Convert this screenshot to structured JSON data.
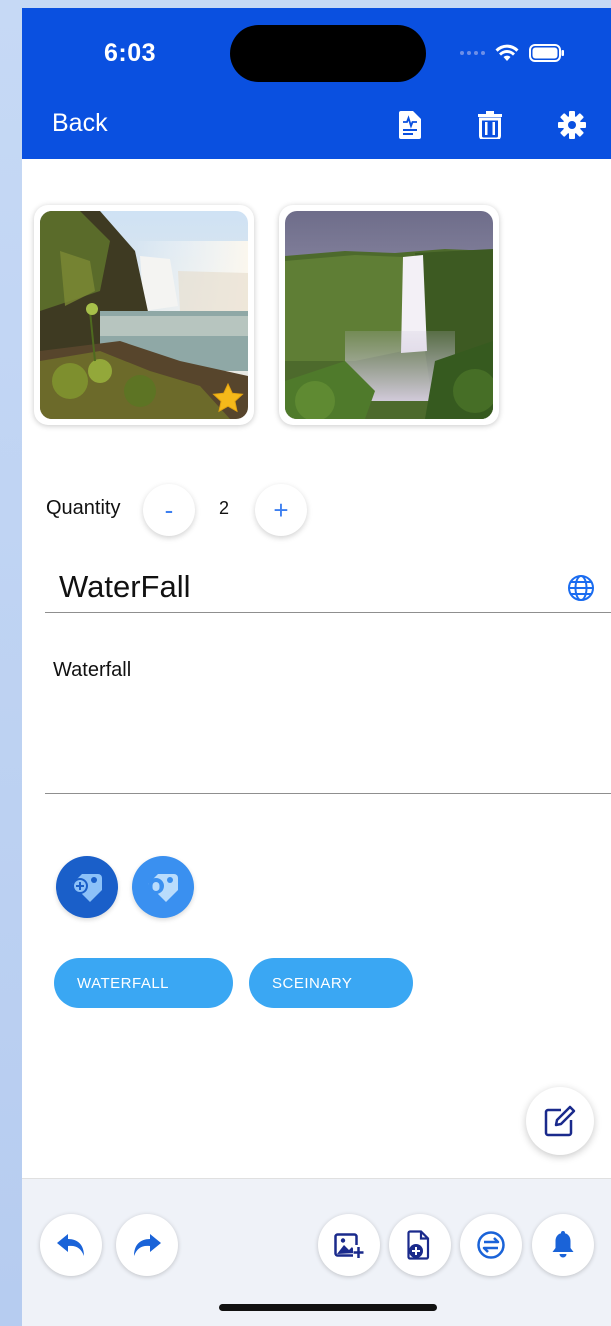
{
  "status": {
    "time": "6:03"
  },
  "header": {
    "back_label": "Back"
  },
  "images": [
    {
      "name": "waterfall-photo-1",
      "favorite": true
    },
    {
      "name": "waterfall-photo-2",
      "favorite": false
    }
  ],
  "quantity": {
    "label": "Quantity",
    "minus": "-",
    "value": "2",
    "plus": "+"
  },
  "item": {
    "title": "WaterFall",
    "description": "Waterfall"
  },
  "tags": [
    "WATERFALL",
    "SCEINARY"
  ],
  "colors": {
    "header": "#0a50e0",
    "accent": "#3d7ff0",
    "chip": "#3aa7f3",
    "star": "#f5b91a"
  }
}
